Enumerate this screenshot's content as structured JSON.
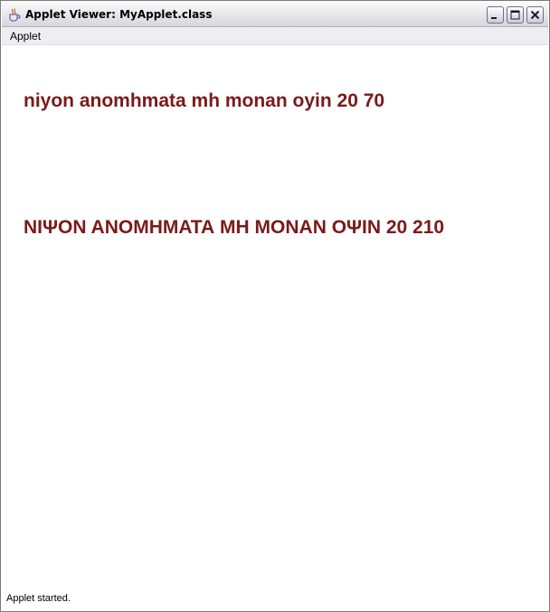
{
  "window": {
    "title": "Applet Viewer: MyApplet.class"
  },
  "menubar": {
    "items": [
      {
        "label": "Applet"
      }
    ]
  },
  "applet": {
    "lines": [
      {
        "text": "niyon anomhmata mh monan oyin 20 70"
      },
      {
        "text": "ΝΙΨΟΝ ΑΝΟΜΗΜΑΤΑ ΜΗ ΜΟΝΑΝ ΟΨΙΝ 20 210"
      }
    ],
    "text_color": "#7a1a1a"
  },
  "status": {
    "text": "Applet started."
  },
  "icons": {
    "app": "java-coffee-cup-icon",
    "minimize": "minimize-icon",
    "maximize": "maximize-icon",
    "close": "close-icon"
  }
}
